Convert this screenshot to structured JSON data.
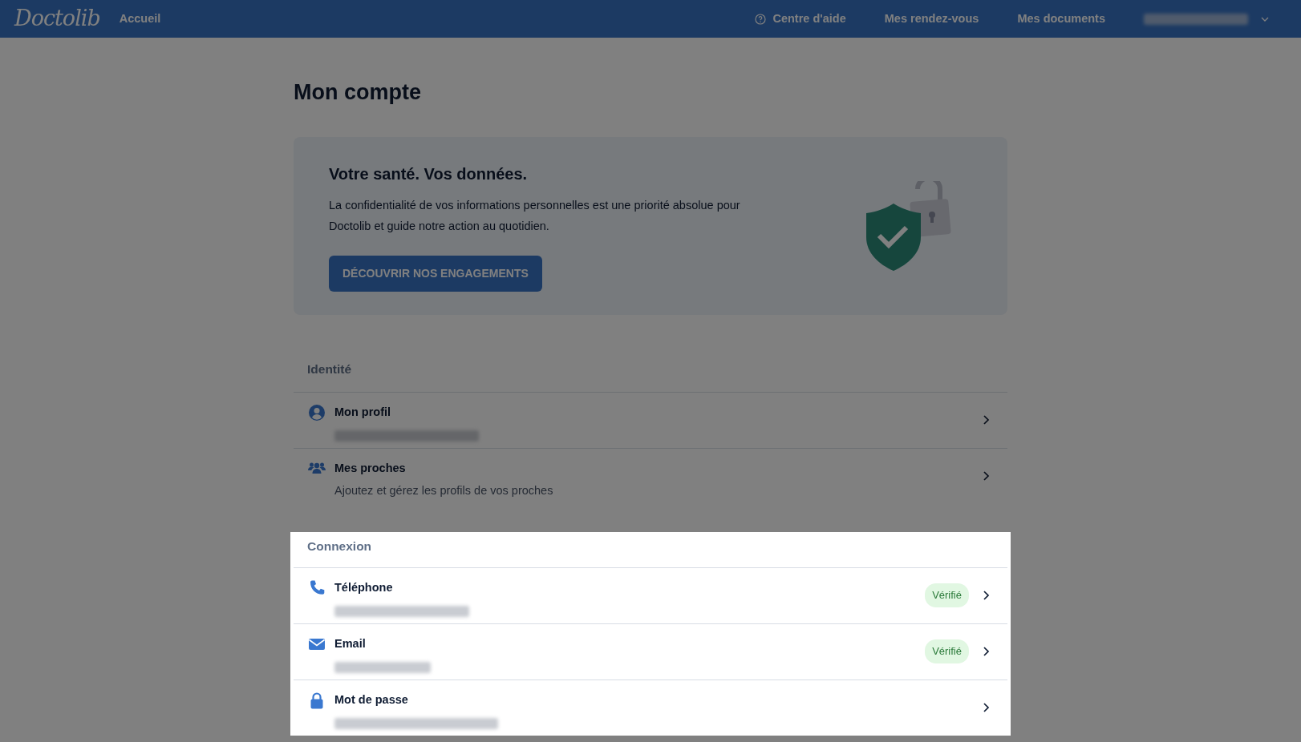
{
  "navbar": {
    "logo": "Doctolib",
    "home_link": "Accueil",
    "links": [
      {
        "label": "Centre d'aide"
      },
      {
        "label": "Mes rendez-vous"
      },
      {
        "label": "Mes documents"
      }
    ],
    "user_redacted": true,
    "dimmed": true
  },
  "page_title": "Mon compte",
  "banner": {
    "title": "Votre santé. Vos données.",
    "text": "La confidentialité de vos informations personnelles est une priorité absolue pour Doctolib et guide notre action au quotidien.",
    "button": "DÉCOUVRIR NOS ENGAGEMENTS",
    "dimmed": true
  },
  "sections": [
    {
      "title": "Identité",
      "highlighted": false,
      "rows": [
        {
          "kind": "person",
          "label": "Mon profil",
          "redacted": true
        },
        {
          "kind": "people",
          "label": "Mes proches",
          "subtitle": "Ajoutez et gérez les profils de vos proches",
          "redacted": false
        }
      ]
    },
    {
      "title": "Connexion",
      "highlighted": true,
      "rows": [
        {
          "kind": "phone",
          "label": "Téléphone",
          "redacted": true,
          "badge": "Vérifié"
        },
        {
          "kind": "mail",
          "label": "Email",
          "redacted": true,
          "badge": "Vérifié"
        },
        {
          "kind": "lock",
          "label": "Mot de passe",
          "redacted": true
        }
      ]
    }
  ]
}
